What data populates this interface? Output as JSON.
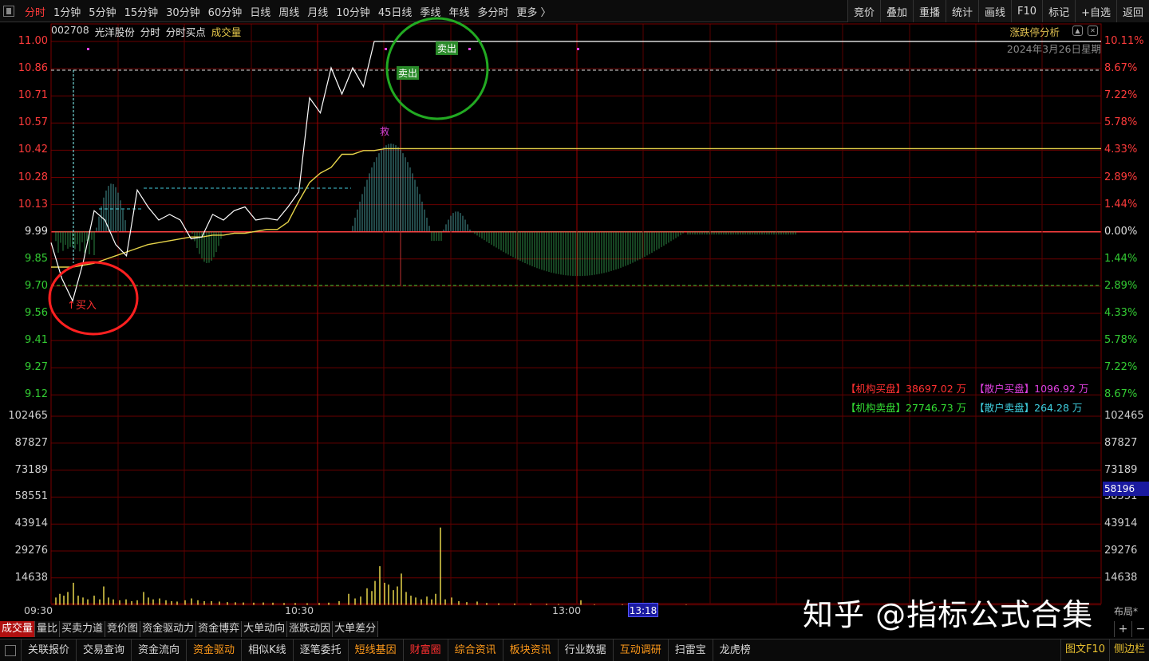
{
  "toolbar": {
    "periods": [
      "分时",
      "1分钟",
      "5分钟",
      "15分钟",
      "30分钟",
      "60分钟",
      "日线",
      "周线",
      "月线",
      "10分钟",
      "45日线",
      "季线",
      "年线",
      "多分时",
      "更多 〉"
    ],
    "active_period": "分时",
    "right_tools": [
      "竞价",
      "叠加",
      "重播",
      "统计",
      "画线",
      "F10",
      "标记",
      "+自选",
      "返回"
    ]
  },
  "chart_header": {
    "code": "002708",
    "name": "光洋股份",
    "items": [
      "分时",
      "分时买点"
    ],
    "volume_label": "成交量",
    "zhangdie": "涨跌停分析",
    "date": "2024年3月26日星期"
  },
  "colors": {
    "up": "#ff3b3b",
    "down": "#33cc33",
    "neutral": "#e0e0e0",
    "grid": "#7a0000",
    "price_line": "#ffffff",
    "avg_line": "#e6d44a",
    "volume": "#e6d44a"
  },
  "price_axis": {
    "left": [
      "11.00",
      "10.86",
      "10.71",
      "10.57",
      "10.42",
      "10.28",
      "10.13",
      "9.99",
      "9.85",
      "9.70",
      "9.56",
      "9.41",
      "9.27",
      "9.12"
    ],
    "right": [
      "10.11%",
      "8.67%",
      "7.22%",
      "5.78%",
      "4.33%",
      "2.89%",
      "1.44%",
      "0.00%",
      "1.44%",
      "2.89%",
      "4.33%",
      "5.78%",
      "7.22%",
      "8.67%"
    ]
  },
  "volume_axis": [
    "102465",
    "87827",
    "73189",
    "58551",
    "43914",
    "29276",
    "14638"
  ],
  "time_axis": [
    "09:30",
    "10:30",
    "13:00"
  ],
  "cursor": {
    "time": "13:18",
    "volume": "58196"
  },
  "annotations": {
    "buy": "买入",
    "sell1": "卖出",
    "sell2": "卖出",
    "rescue": "救"
  },
  "flow": {
    "inst_buy_label": "【机构买盘】",
    "inst_buy_value": "38697.02 万",
    "retail_buy_label": "【散户买盘】",
    "retail_buy_value": "1096.92 万",
    "inst_sell_label": "【机构卖盘】",
    "inst_sell_value": "27746.73 万",
    "retail_sell_label": "【散户卖盘】",
    "retail_sell_value": "264.28 万"
  },
  "indicator_tabs": [
    "成交量",
    "量比",
    "买卖力道",
    "竞价图",
    "资金驱动力",
    "资金博弈",
    "大单动向",
    "涨跌动因",
    "大单差分"
  ],
  "active_indicator": "成交量",
  "layout_label": "布局*",
  "footer_items": [
    {
      "label": "关联报价",
      "style": ""
    },
    {
      "label": "交易查询",
      "style": ""
    },
    {
      "label": "资金流向",
      "style": ""
    },
    {
      "label": "资金驱动",
      "style": "orange"
    },
    {
      "label": "相似K线",
      "style": ""
    },
    {
      "label": "逐笔委托",
      "style": ""
    },
    {
      "label": "短线基因",
      "style": "orange"
    },
    {
      "label": "财富圈",
      "style": "red"
    },
    {
      "label": "综合资讯",
      "style": "orange"
    },
    {
      "label": "板块资讯",
      "style": "orange"
    },
    {
      "label": "行业数据",
      "style": ""
    },
    {
      "label": "互动调研",
      "style": "orange"
    },
    {
      "label": "扫雷宝",
      "style": ""
    },
    {
      "label": "龙虎榜",
      "style": ""
    }
  ],
  "footer_right": [
    "图文F10",
    "侧边栏"
  ],
  "watermark": "知乎 @指标公式合集",
  "chart_data": {
    "type": "line",
    "title": "",
    "xlabel": "",
    "ylabel": "",
    "prev_close": 9.99,
    "ylim": [
      9.12,
      11.0
    ],
    "x": [
      "09:30",
      "09:33",
      "09:36",
      "09:39",
      "09:42",
      "09:45",
      "09:48",
      "09:51",
      "09:54",
      "09:57",
      "10:00",
      "10:03",
      "10:06",
      "10:09",
      "10:12",
      "10:15",
      "10:18",
      "10:21",
      "10:24",
      "10:27",
      "10:30",
      "10:33",
      "10:36",
      "10:39",
      "10:42",
      "10:45",
      "10:48",
      "10:51",
      "10:54",
      "10:57",
      "11:00",
      "11:03",
      "11:06",
      "11:09",
      "11:12",
      "11:15",
      "11:18"
    ],
    "series": [
      {
        "values": [
          9.93,
          9.74,
          9.62,
          9.83,
          10.1,
          10.05,
          9.92,
          9.86,
          10.21,
          10.12,
          10.05,
          10.08,
          10.05,
          9.95,
          9.96,
          10.08,
          10.05,
          10.1,
          10.12,
          10.05,
          10.06,
          10.05,
          10.12,
          10.2,
          10.7,
          10.62,
          10.86,
          10.72,
          10.86,
          10.76,
          11.0,
          11.0,
          11.0,
          11.0,
          11.0,
          11.0,
          11.0
        ]
      },
      {
        "values": [
          9.8,
          9.8,
          9.8,
          9.81,
          9.82,
          9.84,
          9.86,
          9.88,
          9.9,
          9.92,
          9.93,
          9.94,
          9.95,
          9.96,
          9.96,
          9.97,
          9.97,
          9.98,
          9.98,
          9.99,
          10.0,
          10.0,
          10.04,
          10.15,
          10.25,
          10.3,
          10.33,
          10.4,
          10.4,
          10.42,
          10.42,
          10.43,
          10.43,
          10.43,
          10.43,
          10.43,
          10.43
        ]
      }
    ]
  }
}
